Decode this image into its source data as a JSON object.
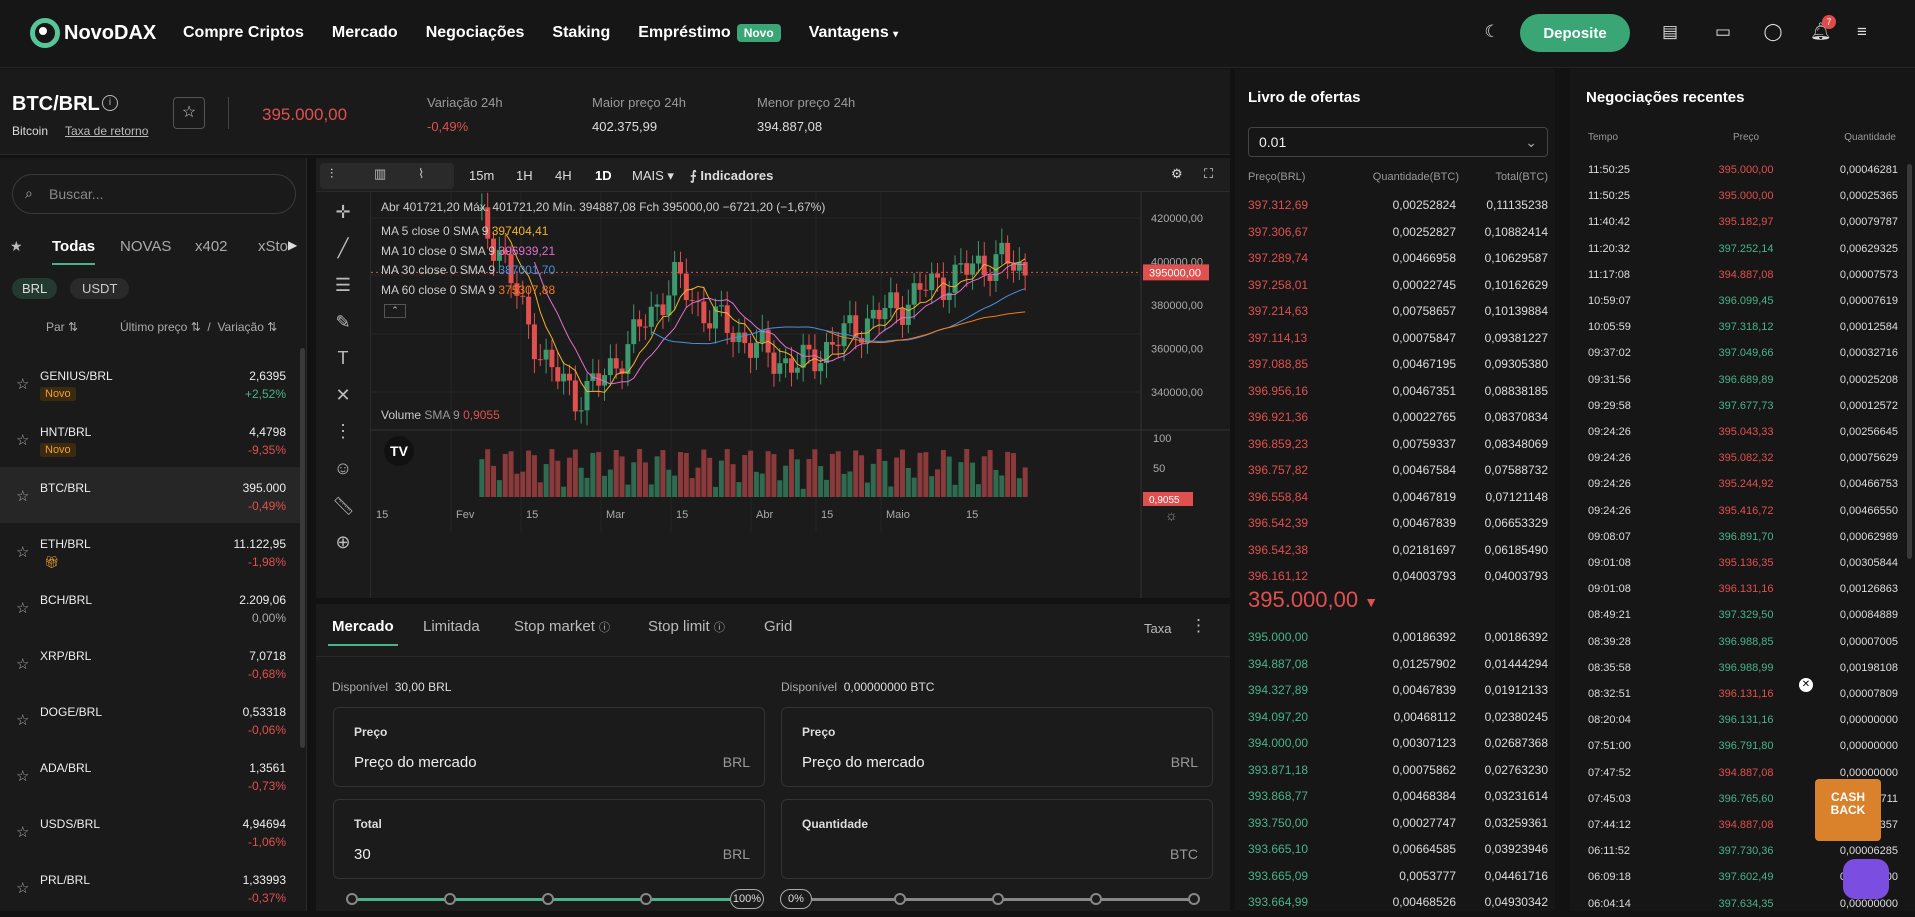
{
  "nav": {
    "brand": "NovoDAX",
    "links": [
      "Compre Criptos",
      "Mercado",
      "Negociações",
      "Staking",
      "Empréstimo",
      "Vantagens"
    ],
    "novo_badge": "Novo",
    "deposit": "Deposite",
    "notif_count": "7"
  },
  "ticker": {
    "pair": "BTC/BRL",
    "coin": "Bitcoin",
    "rate_link": "Taxa de retorno",
    "price": "395.000,00",
    "change_label": "Variação 24h",
    "change": "-0,49%",
    "high_label": "Maior preço 24h",
    "high": "402.375,99",
    "low_label": "Menor preço 24h",
    "low": "394.887,08"
  },
  "markets": {
    "search_placeholder": "Buscar...",
    "tabs": [
      "Todas",
      "NOVAS",
      "x402",
      "xSto"
    ],
    "quotes": [
      "BRL",
      "USDT"
    ],
    "col_pair": "Par",
    "col_price": "Último preço",
    "col_sep": "/",
    "col_change": "Variação",
    "rows": [
      {
        "pair": "GENIUS/BRL",
        "price": "2,6395",
        "change": "+2,52%",
        "dir": "up",
        "tag": "Novo"
      },
      {
        "pair": "HNT/BRL",
        "price": "4,4798",
        "change": "-9,35%",
        "dir": "dn",
        "tag": "Novo"
      },
      {
        "pair": "BTC/BRL",
        "price": "395.000",
        "change": "-0,49%",
        "dir": "dn",
        "tag": ""
      },
      {
        "pair": "ETH/BRL",
        "price": "11.122,95",
        "change": "-1,98%",
        "dir": "dn",
        "tag": ""
      },
      {
        "pair": "BCH/BRL",
        "price": "2.209,06",
        "change": "0,00%",
        "dir": "flat",
        "tag": ""
      },
      {
        "pair": "XRP/BRL",
        "price": "7,0718",
        "change": "-0,68%",
        "dir": "dn",
        "tag": ""
      },
      {
        "pair": "DOGE/BRL",
        "price": "0,53318",
        "change": "-0,06%",
        "dir": "dn",
        "tag": ""
      },
      {
        "pair": "ADA/BRL",
        "price": "1,3561",
        "change": "-0,73%",
        "dir": "dn",
        "tag": ""
      },
      {
        "pair": "USDS/BRL",
        "price": "4,94694",
        "change": "-1,06%",
        "dir": "dn",
        "tag": ""
      },
      {
        "pair": "PRL/BRL",
        "price": "1,33993",
        "change": "-0,37%",
        "dir": "dn",
        "tag": ""
      }
    ]
  },
  "chart": {
    "intervals": [
      "15m",
      "1H",
      "4H",
      "1D"
    ],
    "more": "MAIS",
    "indicators": "Indicadores",
    "ohlc": "Abr 401721,20  Máx. 401721,20  Mín. 394887,08  Fch 395000,00  −6721,20 (−1,67%)",
    "ma": [
      {
        "label": "MA 5 close 0 SMA 9",
        "value": "397404,41",
        "color": "#f0b429"
      },
      {
        "label": "MA 10 close 0 SMA 9",
        "value": "396939,21",
        "color": "#e06fd0"
      },
      {
        "label": "MA 30 close 0 SMA 9",
        "value": "387001,70",
        "color": "#4a90e2"
      },
      {
        "label": "MA 60 close 0 SMA 9",
        "value": "375307,88",
        "color": "#f07a1a"
      }
    ],
    "yticks": [
      "420000,00",
      "400000,00",
      "380000,00",
      "360000,00",
      "340000,00"
    ],
    "last": "395000,00",
    "vol_label": "Volume",
    "vol_sma": "SMA 9",
    "vol_val": "0,9055",
    "vol_ticks": [
      "100",
      "50"
    ],
    "vol_last": "0,9055",
    "xticks": [
      "15",
      "Fev",
      "15",
      "Mar",
      "15",
      "Abr",
      "15",
      "Maio",
      "15"
    ]
  },
  "form": {
    "tabs": [
      "Mercado",
      "Limitada",
      "Stop market",
      "Stop limit",
      "Grid"
    ],
    "fee": "Taxa",
    "avail_label": "Disponível",
    "avail_brl": "30,00 BRL",
    "avail_btc": "0,00000000 BTC",
    "price_label": "Preço",
    "market_price": "Preço do mercado",
    "brl": "BRL",
    "btc": "BTC",
    "total_label": "Total",
    "total_value": "30",
    "qty_label": "Quantidade",
    "pct_full": "100%",
    "pct_zero": "0%"
  },
  "book": {
    "title": "Livro de ofertas",
    "step": "0.01",
    "h_price": "Preço(BRL)",
    "h_qty": "Quantidade(BTC)",
    "h_total": "Total(BTC)",
    "mid": "395.000,00",
    "asks": [
      [
        "397.312,69",
        "0,00252824",
        "0,11135238"
      ],
      [
        "397.306,67",
        "0,00252827",
        "0,10882414"
      ],
      [
        "397.289,74",
        "0,00466958",
        "0,10629587"
      ],
      [
        "397.258,01",
        "0,00022745",
        "0,10162629"
      ],
      [
        "397.214,63",
        "0,00758657",
        "0,10139884"
      ],
      [
        "397.114,13",
        "0,00075847",
        "0,09381227"
      ],
      [
        "397.088,85",
        "0,00467195",
        "0,09305380"
      ],
      [
        "396.956,16",
        "0,00467351",
        "0,08838185"
      ],
      [
        "396.921,36",
        "0,00022765",
        "0,08370834"
      ],
      [
        "396.859,23",
        "0,00759337",
        "0,08348069"
      ],
      [
        "396.757,82",
        "0,00467584",
        "0,07588732"
      ],
      [
        "396.558,84",
        "0,00467819",
        "0,07121148"
      ],
      [
        "396.542,39",
        "0,00467839",
        "0,06653329"
      ],
      [
        "396.542,38",
        "0,02181697",
        "0,06185490"
      ],
      [
        "396.161,12",
        "0,04003793",
        "0,04003793"
      ]
    ],
    "bids": [
      [
        "395.000,00",
        "0,00186392",
        "0,00186392"
      ],
      [
        "394.887,08",
        "0,01257902",
        "0,01444294"
      ],
      [
        "394.327,89",
        "0,00467839",
        "0,01912133"
      ],
      [
        "394.097,20",
        "0,00468112",
        "0,02380245"
      ],
      [
        "394.000,00",
        "0,00307123",
        "0,02687368"
      ],
      [
        "393.871,18",
        "0,00075862",
        "0,02763230"
      ],
      [
        "393.868,77",
        "0,00468384",
        "0,03231614"
      ],
      [
        "393.750,00",
        "0,00027747",
        "0,03259361"
      ],
      [
        "393.665,10",
        "0,00664585",
        "0,03923946"
      ],
      [
        "393.665,09",
        "0,0053777",
        "0,04461716"
      ],
      [
        "393.664,99",
        "0,00468526",
        "0,04930342"
      ]
    ]
  },
  "trades": {
    "title": "Negociações recentes",
    "h_time": "Tempo",
    "h_price": "Preço",
    "h_qty": "Quantidade",
    "cashback": "CASH BACK",
    "rows": [
      [
        "11:50:25",
        "395.000,00",
        "0,00046281",
        "dn"
      ],
      [
        "11:50:25",
        "395.000,00",
        "0,00025365",
        "dn"
      ],
      [
        "11:40:42",
        "395.182,97",
        "0,00079787",
        "dn"
      ],
      [
        "11:20:32",
        "397.252,14",
        "0,00629325",
        "up"
      ],
      [
        "11:17:08",
        "394.887,08",
        "0,00007573",
        "dn"
      ],
      [
        "10:59:07",
        "396.099,45",
        "0,00007619",
        "up"
      ],
      [
        "10:05:59",
        "397.318,12",
        "0,00012584",
        "up"
      ],
      [
        "09:37:02",
        "397.049,66",
        "0,00032716",
        "up"
      ],
      [
        "09:31:56",
        "396.689,89",
        "0,00025208",
        "up"
      ],
      [
        "09:29:58",
        "397.677,73",
        "0,00012572",
        "up"
      ],
      [
        "09:24:26",
        "395.043,33",
        "0,00256645",
        "dn"
      ],
      [
        "09:24:26",
        "395.082,32",
        "0,00075629",
        "dn"
      ],
      [
        "09:24:26",
        "395.244,92",
        "0,00466753",
        "dn"
      ],
      [
        "09:24:26",
        "395.416,72",
        "0,00466550",
        "dn"
      ],
      [
        "09:08:07",
        "396.891,70",
        "0,00062989",
        "up"
      ],
      [
        "09:01:08",
        "395.136,35",
        "0,00305844",
        "dn"
      ],
      [
        "09:01:08",
        "396.131,16",
        "0,00126863",
        "dn"
      ],
      [
        "08:49:21",
        "397.329,50",
        "0,00084889",
        "up"
      ],
      [
        "08:39:28",
        "396.988,85",
        "0,00007005",
        "up"
      ],
      [
        "08:35:58",
        "396.988,99",
        "0,00198108",
        "up"
      ],
      [
        "08:32:51",
        "396.131,16",
        "0,00007809",
        "dn"
      ],
      [
        "08:20:04",
        "396.131,16",
        "0,00000000",
        "up"
      ],
      [
        "07:51:00",
        "396.791,80",
        "0,00000000",
        "up"
      ],
      [
        "07:47:52",
        "394.887,08",
        "0,00000000",
        "dn"
      ],
      [
        "07:45:03",
        "396.765,60",
        "0,00006711",
        "up"
      ],
      [
        "07:44:12",
        "394.887,08",
        "0,00031357",
        "dn"
      ],
      [
        "06:11:52",
        "397.730,36",
        "0,00006285",
        "up"
      ],
      [
        "06:09:18",
        "397.602,49",
        "0,00000000",
        "up"
      ],
      [
        "06:04:14",
        "397.634,35",
        "0,00000000",
        "up"
      ]
    ]
  }
}
